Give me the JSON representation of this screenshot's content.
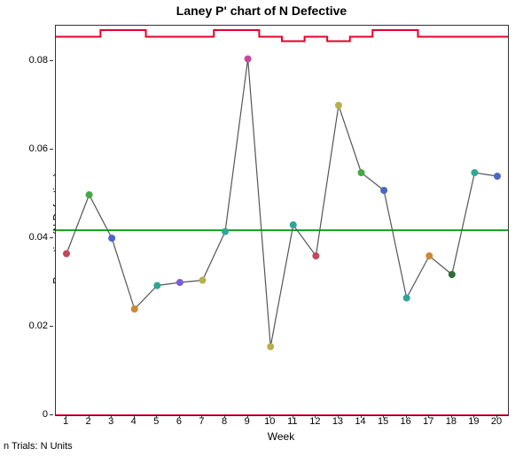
{
  "title": "Laney P' chart of N Defective",
  "ylabel": "Proportion(N Defective)",
  "xlabel": "Week",
  "footnote": "n Trials: N Units",
  "chart_data": {
    "type": "line",
    "xlabel": "Week",
    "ylabel": "Proportion(N Defective)",
    "title": "Laney P' chart of N Defective",
    "centerline": 0.0418,
    "ucl": [
      0.0855,
      0.0855,
      0.087,
      0.087,
      0.0855,
      0.0855,
      0.0855,
      0.087,
      0.087,
      0.0855,
      0.0845,
      0.0855,
      0.0845,
      0.0855,
      0.087,
      0.087,
      0.0855,
      0.0855,
      0.0855,
      0.0855
    ],
    "lcl_value": 0.0,
    "ylim": [
      0,
      0.088
    ],
    "x": [
      1,
      2,
      3,
      4,
      5,
      6,
      7,
      8,
      9,
      10,
      11,
      12,
      13,
      14,
      15,
      16,
      17,
      18,
      19,
      20
    ],
    "yticks": [
      0,
      0.02,
      0.04,
      0.06,
      0.08
    ],
    "series": [
      {
        "name": "Proportion(N Defective)",
        "values": [
          0.0365,
          0.0498,
          0.04,
          0.024,
          0.0293,
          0.03,
          0.0305,
          0.0415,
          0.0805,
          0.0155,
          0.043,
          0.036,
          0.07,
          0.0548,
          0.0508,
          0.0265,
          0.036,
          0.0318,
          0.0548,
          0.054
        ],
        "colors": [
          "#c2485a",
          "#45a845",
          "#4a66c8",
          "#cc8833",
          "#2fa696",
          "#7a5fd6",
          "#b8b04a",
          "#2fa696",
          "#c24a9b",
          "#b8b04a",
          "#2fa696",
          "#c2485a",
          "#b8b04a",
          "#45a845",
          "#4a66c8",
          "#2fa696",
          "#cc8833",
          "#2f6e3a",
          "#2fa696",
          "#4a66c8"
        ]
      }
    ]
  }
}
